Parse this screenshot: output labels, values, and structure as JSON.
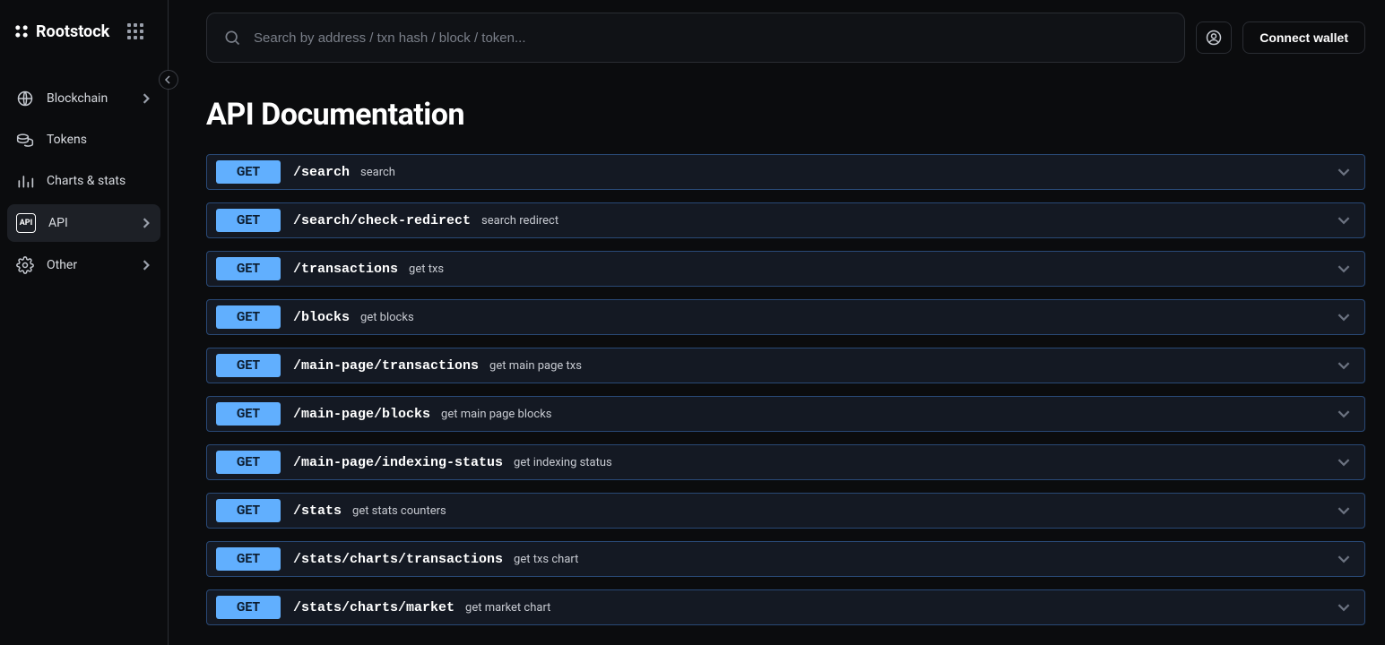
{
  "brand": "Rootstock",
  "search": {
    "placeholder": "Search by address / txn hash / block / token..."
  },
  "header": {
    "wallet_label": "Connect wallet"
  },
  "sidebar": {
    "items": [
      {
        "label": "Blockchain",
        "icon": "globe-icon",
        "has_chevron": true
      },
      {
        "label": "Tokens",
        "icon": "coins-icon",
        "has_chevron": false
      },
      {
        "label": "Charts & stats",
        "icon": "bars-icon",
        "has_chevron": false
      },
      {
        "label": "API",
        "icon": "api-icon",
        "has_chevron": true,
        "active": true
      },
      {
        "label": "Other",
        "icon": "gear-icon",
        "has_chevron": true
      }
    ]
  },
  "page": {
    "title": "API Documentation"
  },
  "endpoints": [
    {
      "method": "GET",
      "path": "/search",
      "desc": "search"
    },
    {
      "method": "GET",
      "path": "/search/check-redirect",
      "desc": "search redirect"
    },
    {
      "method": "GET",
      "path": "/transactions",
      "desc": "get txs"
    },
    {
      "method": "GET",
      "path": "/blocks",
      "desc": "get blocks"
    },
    {
      "method": "GET",
      "path": "/main-page/transactions",
      "desc": "get main page txs"
    },
    {
      "method": "GET",
      "path": "/main-page/blocks",
      "desc": "get main page blocks"
    },
    {
      "method": "GET",
      "path": "/main-page/indexing-status",
      "desc": "get indexing status"
    },
    {
      "method": "GET",
      "path": "/stats",
      "desc": "get stats counters"
    },
    {
      "method": "GET",
      "path": "/stats/charts/transactions",
      "desc": "get txs chart"
    },
    {
      "method": "GET",
      "path": "/stats/charts/market",
      "desc": "get market chart"
    }
  ]
}
